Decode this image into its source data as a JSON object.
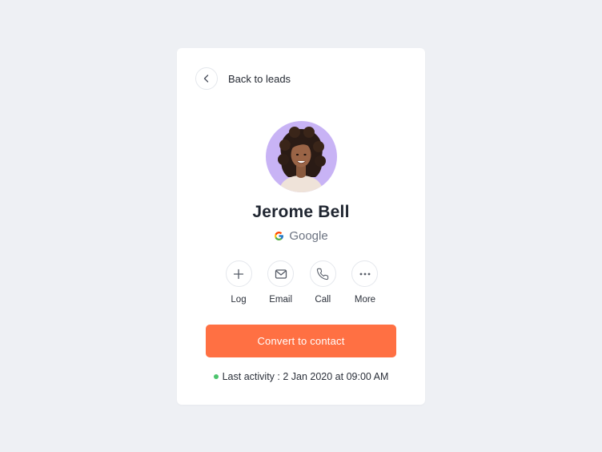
{
  "nav": {
    "back_label": "Back to leads",
    "back_icon": "chevron-left-icon"
  },
  "profile": {
    "name": "Jerome Bell",
    "company": "Google",
    "company_icon": "google-logo-icon",
    "avatar_background": "#c8b3f5"
  },
  "actions": [
    {
      "label": "Log",
      "icon": "plus-icon"
    },
    {
      "label": "Email",
      "icon": "mail-icon"
    },
    {
      "label": "Call",
      "icon": "phone-icon"
    },
    {
      "label": "More",
      "icon": "more-dots-icon"
    }
  ],
  "primary_button": {
    "label": "Convert to contact",
    "color": "#ff7043"
  },
  "activity": {
    "label": "Last activity : ",
    "value": "2 Jan 2020 at 09:00 AM",
    "status_color": "#4cc46d"
  },
  "colors": {
    "page_background": "#eef0f4",
    "card_background": "#ffffff",
    "text_primary": "#1f2530"
  }
}
